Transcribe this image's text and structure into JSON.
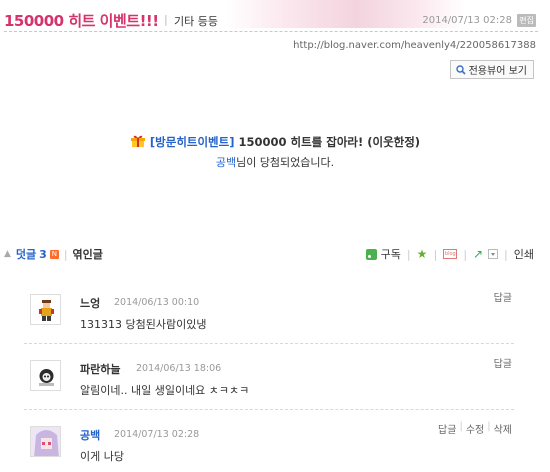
{
  "post": {
    "title": "150000 히트 이벤트!!!",
    "separator": "|",
    "category": "기타 등등",
    "date": "2014/07/13 02:28",
    "date_badge": "편집",
    "url": "http://blog.naver.com/heavenly4/220058617388",
    "view_button_label": "전용뷰어 보기",
    "event_tag": "[방문히트이벤트]",
    "event_text": " 150000 히트를 잡아라! (이웃한정)",
    "winner_name": "공백",
    "winner_suffix": "님이 당첨되었습니다."
  },
  "comment_bar": {
    "comments_label": "덧글",
    "comments_count": "3",
    "new_badge": "N",
    "pipe": "|",
    "sympathy_label": "엮인글",
    "subscribe_label": "구독",
    "print_label": "인쇄",
    "blog_icon_text": "blog"
  },
  "comments": [
    {
      "name": "느엉",
      "date": "2014/06/13 00:10",
      "text": "131313 당첨된사람이있냉",
      "actions": [
        "답글"
      ]
    },
    {
      "name": "파란하늘",
      "date": "2014/06/13 18:06",
      "text": "알림이네.. 내일 생일이네요 ㅊㅋㅊㅋ",
      "actions": [
        "답글"
      ]
    },
    {
      "name": "공백",
      "date": "2014/07/13 02:28",
      "text": "이게 나당",
      "actions": [
        "답글",
        "수정",
        "삭제"
      ]
    }
  ],
  "colors": {
    "title": "#d6336c",
    "link": "#2563c9",
    "new_badge": "#ff6b2b"
  }
}
